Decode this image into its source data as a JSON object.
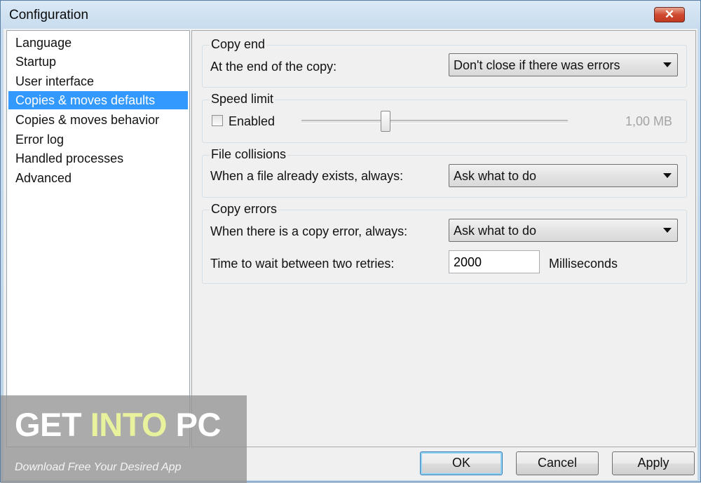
{
  "window": {
    "title": "Configuration",
    "close_glyph": "✕"
  },
  "nav": {
    "items": [
      {
        "label": "Language"
      },
      {
        "label": "Startup"
      },
      {
        "label": "User interface"
      },
      {
        "label": "Copies & moves defaults",
        "selected": true
      },
      {
        "label": "Copies & moves behavior"
      },
      {
        "label": "Error log"
      },
      {
        "label": "Handled processes"
      },
      {
        "label": "Advanced"
      }
    ]
  },
  "copy_end": {
    "title": "Copy end",
    "label": "At the end of the copy:",
    "value": "Don't close if there was errors"
  },
  "speed_limit": {
    "title": "Speed limit",
    "enabled_label": "Enabled",
    "enabled": false,
    "value_text": "1,00 MB",
    "slider_fraction": 0.31
  },
  "file_collisions": {
    "title": "File collisions",
    "label": "When a file already exists, always:",
    "value": "Ask what to do"
  },
  "copy_errors": {
    "title": "Copy errors",
    "label": "When there is a copy error, always:",
    "value": "Ask what to do",
    "retry_label": "Time to wait between two retries:",
    "retry_value": "2000",
    "retry_unit": "Milliseconds"
  },
  "buttons": {
    "ok": "OK",
    "cancel": "Cancel",
    "apply": "Apply"
  },
  "watermark": {
    "logo_part1": "GET ",
    "logo_part2": "INTO",
    "logo_part3": " PC",
    "tagline": "Download Free Your Desired App"
  },
  "colors": {
    "selection": "#3399ff",
    "watermark_accent": "#e8f29d"
  }
}
